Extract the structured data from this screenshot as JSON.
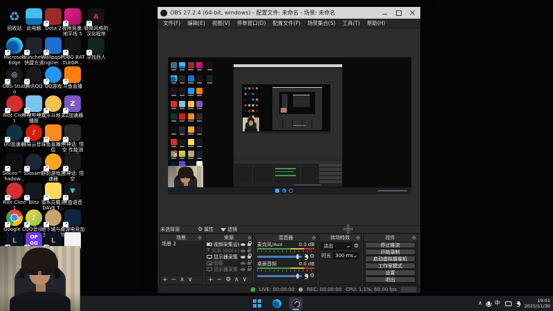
{
  "desktop": {
    "icons": [
      {
        "label": "回收站",
        "name": "recycle-bin",
        "col": 1,
        "row": 1,
        "bg": "none",
        "glyph": "♻",
        "fg": "#4aa3e0",
        "shape": "square",
        "shortcut": false
      },
      {
        "label": "此电脑",
        "name": "this-pc",
        "col": 2,
        "row": 1,
        "bg": "linear-gradient(180deg,#45bdee 0 60%,#0f72b4 60% 100%)",
        "glyph": "",
        "fg": "#fff",
        "shape": "square",
        "shortcut": false
      },
      {
        "label": "Dota 2",
        "name": "dota-2",
        "col": 3,
        "row": 1,
        "bg": "#9d2b2b",
        "glyph": "",
        "fg": "#fff",
        "shape": "square",
        "shortcut": true
      },
      {
        "label": "极限竞速: 地平线 5",
        "name": "forza-horizon-5",
        "col": 4,
        "row": 1,
        "bg": "linear-gradient(135deg,#e91e8c,#a41360)",
        "glyph": "",
        "fg": "#fff",
        "shape": "square",
        "shortcut": true
      },
      {
        "label": "极简风格的汉化程序",
        "name": "localization-tool",
        "col": 5,
        "row": 1,
        "bg": "#141414",
        "glyph": "A",
        "fg": "#e03333",
        "shape": "square",
        "shortcut": true
      },
      {
        "label": "Microsoft Edge",
        "name": "microsoft-edge",
        "col": 1,
        "row": 2,
        "bg": "radial-gradient(circle at 38% 62%,#0c59a4 0 35%,#2ccdea 65%,#9be15d 100%)",
        "glyph": "",
        "fg": "#fff",
        "shape": "circle",
        "shortcut": true
      },
      {
        "label": "launcher - 快捷方式",
        "name": "launcher-shortcut",
        "col": 2,
        "row": 2,
        "bg": "#23242b",
        "glyph": "",
        "fg": "#f4c542",
        "shape": "square",
        "shortcut": true
      },
      {
        "label": "Wallpaper Engine: ...",
        "name": "wallpaper-engine",
        "col": 3,
        "row": 2,
        "bg": "#1b6fd0",
        "glyph": "",
        "fg": "#fff",
        "shape": "square",
        "shortcut": true
      },
      {
        "label": "PUBG BATTLEGR...",
        "name": "pubg",
        "col": 4,
        "row": 2,
        "bg": "#161616",
        "glyph": "",
        "fg": "#ddd",
        "shape": "square",
        "shortcut": true
      },
      {
        "label": "寻找西人",
        "name": "finding-game",
        "col": 5,
        "row": 2,
        "bg": "#11271d",
        "glyph": "",
        "fg": "#3e8f5a",
        "shape": "square",
        "shortcut": true
      },
      {
        "label": "OBS Studio",
        "name": "obs-studio",
        "col": 1,
        "row": 3,
        "bg": "#17181c",
        "glyph": "◎",
        "fg": "#e8e8e8",
        "shape": "circle",
        "shortcut": true
      },
      {
        "label": "腾讯QQ",
        "name": "tencent-qq",
        "col": 2,
        "row": 3,
        "bg": "#1a1a1a",
        "glyph": "",
        "fg": "#e33",
        "shape": "circle",
        "shortcut": true
      },
      {
        "label": "QQ游戏",
        "name": "qq-games",
        "col": 3,
        "row": 3,
        "bg": "#2196f3",
        "glyph": "",
        "fg": "#fff",
        "shape": "circle",
        "shortcut": true
      },
      {
        "label": "斗鱼直播",
        "name": "douyu-live",
        "col": 4,
        "row": 3,
        "bg": "#ff7e00",
        "glyph": "",
        "fg": "#fff",
        "shape": "square",
        "shortcut": true
      },
      {
        "label": "Riot Client",
        "name": "riot-client",
        "col": 1,
        "row": 4,
        "bg": "#d32f2f",
        "glyph": "",
        "fg": "#fff",
        "shape": "circle",
        "shortcut": true
      },
      {
        "label": "哔哩哔哩直播姬",
        "name": "bilibili-live",
        "col": 2,
        "row": 4,
        "bg": "#7cc5f0",
        "glyph": "",
        "fg": "#fff",
        "shape": "square",
        "shortcut": true
      },
      {
        "label": "欢乐斗地主",
        "name": "doudizhu",
        "col": 3,
        "row": 4,
        "bg": "#f3c14b",
        "glyph": "",
        "fg": "#8a3b1f",
        "shape": "circle",
        "shortcut": true
      },
      {
        "label": "ZZ加速器",
        "name": "zz-booster",
        "col": 4,
        "row": 4,
        "bg": "#7e57c2",
        "glyph": "Z",
        "fg": "#fff",
        "shape": "square",
        "shortcut": true
      },
      {
        "label": "UU加速器",
        "name": "uu-booster",
        "col": 1,
        "row": 5,
        "bg": "#0e3340",
        "glyph": "",
        "fg": "#2dd3c0",
        "shape": "circle",
        "shortcut": true
      },
      {
        "label": "网易云音乐",
        "name": "netease-music",
        "col": 2,
        "row": 5,
        "bg": "#d81e06",
        "glyph": "♪",
        "fg": "#fff",
        "shape": "circle",
        "shortcut": true
      },
      {
        "label": "斗鱼直播伴侣",
        "name": "douyu-companion",
        "col": 3,
        "row": 5,
        "bg": "#ff8a1e",
        "glyph": "",
        "fg": "#fff",
        "shape": "square",
        "shortcut": true
      },
      {
        "label": "黑神话: 悟空 性能测试工具",
        "name": "wukong-benchmark",
        "col": 4,
        "row": 5,
        "bg": "#2e2d2b",
        "glyph": "",
        "fg": "#bbb",
        "shape": "square",
        "shortcut": true
      },
      {
        "label": "Sekiro™ Shadow...",
        "name": "sekiro",
        "col": 1,
        "row": 6,
        "bg": "#101010",
        "glyph": "",
        "fg": "#ddd",
        "shape": "square",
        "shortcut": true
      },
      {
        "label": "Steam",
        "name": "steam",
        "col": 2,
        "row": 6,
        "bg": "#1b2838",
        "glyph": "",
        "fg": "#cfe3f5",
        "shape": "circle",
        "shortcut": true
      },
      {
        "label": "野豹游戏加速器",
        "name": "yebao-booster",
        "col": 3,
        "row": 6,
        "bg": "#f5a623",
        "glyph": "",
        "fg": "#fff",
        "shape": "circle",
        "shortcut": true
      },
      {
        "label": "黑神话: 悟空",
        "name": "black-myth-wukong",
        "col": 4,
        "row": 6,
        "bg": "#1c1c1c",
        "glyph": "",
        "fg": "#999",
        "shape": "square",
        "shortcut": true
      },
      {
        "label": "Riot Client",
        "name": "riot-client-2",
        "col": 1,
        "row": 7,
        "bg": "#d32f2f",
        "glyph": "",
        "fg": "#fff",
        "shape": "circle",
        "shortcut": true
      },
      {
        "label": "Blitz",
        "name": "blitz",
        "col": 2,
        "row": 7,
        "bg": "#16171d",
        "glyph": "",
        "fg": "#e0435a",
        "shape": "square",
        "shortcut": true
      },
      {
        "label": "潜水员戴夫 DAVE T...",
        "name": "dave-the-diver",
        "col": 3,
        "row": 7,
        "bg": "#ffd95e",
        "glyph": "",
        "fg": "#2a5ca8",
        "shape": "square",
        "shortcut": true
      },
      {
        "label": "黑盒语音",
        "name": "heibox-voice",
        "col": 4,
        "row": 7,
        "bg": "#15181c",
        "glyph": "▼",
        "fg": "#35d0a0",
        "shape": "square",
        "shortcut": true
      },
      {
        "label": "Google Chrome",
        "name": "google-chrome",
        "col": 1,
        "row": 8,
        "bg": "radial-gradient(circle at 50% 50%,#4285f4 0 26%,#fff 28% 33%,rgba(0,0,0,0) 34%),conic-gradient(from -45deg,#ea4335 0 120deg,#fbbc05 0 240deg,#34a853 0 360deg)",
        "glyph": "",
        "fg": "#fff",
        "shape": "circle",
        "shortcut": true
      },
      {
        "label": "QQ音乐",
        "name": "qq-music",
        "col": 2,
        "row": 8,
        "bg": "linear-gradient(135deg,#f6d84a,#8bc34a)",
        "glyph": "♪",
        "fg": "#fff",
        "shape": "circle",
        "shortcut": true
      },
      {
        "label": "地下城与勇士: 创新世纪",
        "name": "dnf",
        "col": 3,
        "row": 8,
        "bg": "#caa36b",
        "glyph": "",
        "fg": "#5a3a1a",
        "shape": "circle",
        "shortcut": true
      },
      {
        "label": "奇游电竞加速器",
        "name": "qiyou-booster",
        "col": 4,
        "row": 8,
        "bg": "#10243e",
        "glyph": "",
        "fg": "#f4c542",
        "shape": "square",
        "shortcut": true
      },
      {
        "label": "",
        "name": "league-of-legends",
        "col": 1,
        "row": 9,
        "bg": "#0a1428",
        "glyph": "L",
        "fg": "#c8952f",
        "shape": "square",
        "shortcut": true
      },
      {
        "label": "",
        "name": "op-gg",
        "col": 2,
        "row": 9,
        "bg": "#6a3de8",
        "glyph": "OP GG",
        "fg": "#fff",
        "shape": "square",
        "shortcut": true
      },
      {
        "label": "",
        "name": "league-of-legends-2",
        "col": 3,
        "row": 9,
        "bg": "#0a1428",
        "glyph": "L",
        "fg": "#c8952f",
        "shape": "square",
        "shortcut": true
      },
      {
        "label": "",
        "name": "document",
        "col": 4,
        "row": 9,
        "bg": "#f2f2f2",
        "glyph": "",
        "fg": "#888",
        "shape": "page",
        "shortcut": false
      }
    ],
    "taskbar": {
      "tray_chevron": "∧",
      "ime": "中",
      "time": "19:01",
      "date": "2025/11/30"
    }
  },
  "obs": {
    "title": "OBS 27.2.4 (64-bit, windows) - 配置文件: 未命名 - 场景: 未命名",
    "menu": [
      "文件(F)",
      "编辑(E)",
      "视图(V)",
      "停靠窗口(D)",
      "配置文件(P)",
      "场景集合(S)",
      "工具(T)",
      "帮助(H)"
    ],
    "source_toolbar": {
      "no_source": "未选择源",
      "properties": "属性",
      "filters": "滤镜"
    },
    "docks": {
      "scenes": {
        "title": "场景",
        "items": [
          "场景 2"
        ],
        "toolbar": [
          "add",
          "remove",
          "up",
          "down"
        ]
      },
      "sources": {
        "title": "来源",
        "toolbar": [
          "add",
          "remove",
          "gear",
          "up",
          "down"
        ],
        "items": [
          {
            "name": "视频采集设备",
            "icon": "camera",
            "dim": false
          },
          {
            "name": "文本 (GDI+)",
            "icon": "text",
            "dim": true
          },
          {
            "name": "显示器采集 2",
            "icon": "monitor",
            "dim": false
          },
          {
            "name": "图像",
            "icon": "image",
            "dim": true
          },
          {
            "name": "显示器采集",
            "icon": "monitor",
            "dim": true
          }
        ]
      },
      "mixer": {
        "title": "混音器",
        "channels": [
          {
            "name": "麦克风/Aux",
            "db": "0.0 dB",
            "slider_pct": 88
          },
          {
            "name": "桌面音频",
            "db": "0.0 dB",
            "slider_pct": 88
          }
        ]
      },
      "transitions": {
        "title": "转场特效",
        "selected": "淡出",
        "duration_label": "时长",
        "duration_value": "300 ms"
      },
      "controls": {
        "title": "控件",
        "buttons": [
          "停止推流",
          "开始录制",
          "启动虚拟摄像机",
          "工作室模式",
          "设置",
          "退出"
        ]
      }
    },
    "status": {
      "live": "LIVE: 00:00:00",
      "rec": "REC: 00:00:00",
      "cpu": "CPU: 1.1%, 60.00 fps"
    }
  },
  "colors": {
    "accent_blue": "#3f7fbf",
    "meter_green": "#3fae3f",
    "live_green": "#3faa3f",
    "titlebar_gray": "#d6d6d6"
  },
  "icon_glyph_map": {
    "add": "+",
    "remove": "−",
    "gear": "⚙",
    "up": "∧",
    "down": "∨"
  }
}
